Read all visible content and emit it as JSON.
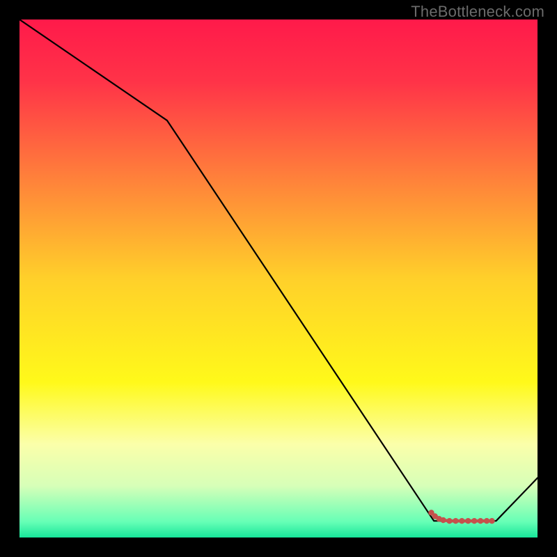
{
  "attribution": "TheBottleneck.com",
  "chart_data": {
    "type": "line",
    "title": "",
    "xlabel": "",
    "ylabel": "",
    "xlim": [
      0,
      10
    ],
    "ylim": [
      0,
      100
    ],
    "background_gradient": {
      "stops": [
        {
          "pos": 0.0,
          "color": "#ff1a4a"
        },
        {
          "pos": 0.12,
          "color": "#ff3348"
        },
        {
          "pos": 0.3,
          "color": "#ff7e3b"
        },
        {
          "pos": 0.5,
          "color": "#ffd02a"
        },
        {
          "pos": 0.7,
          "color": "#fff91a"
        },
        {
          "pos": 0.82,
          "color": "#fbffaa"
        },
        {
          "pos": 0.9,
          "color": "#d7ffb8"
        },
        {
          "pos": 0.97,
          "color": "#66ffb6"
        },
        {
          "pos": 1.0,
          "color": "#17e69a"
        }
      ]
    },
    "series": [
      {
        "name": "baseline",
        "color": "#000000",
        "x": [
          0.0,
          2.85,
          8.0,
          9.2,
          10.0
        ],
        "y": [
          100,
          80.5,
          3.2,
          3.2,
          11.5
        ]
      },
      {
        "name": "minimum-band",
        "color": "#c5514c",
        "marker": true,
        "x": [
          7.95,
          8.02,
          8.1,
          8.18,
          8.3,
          8.42,
          8.54,
          8.66,
          8.78,
          8.9,
          9.02,
          9.12
        ],
        "y": [
          4.8,
          4.1,
          3.6,
          3.35,
          3.2,
          3.2,
          3.2,
          3.2,
          3.2,
          3.2,
          3.2,
          3.2
        ]
      }
    ]
  }
}
